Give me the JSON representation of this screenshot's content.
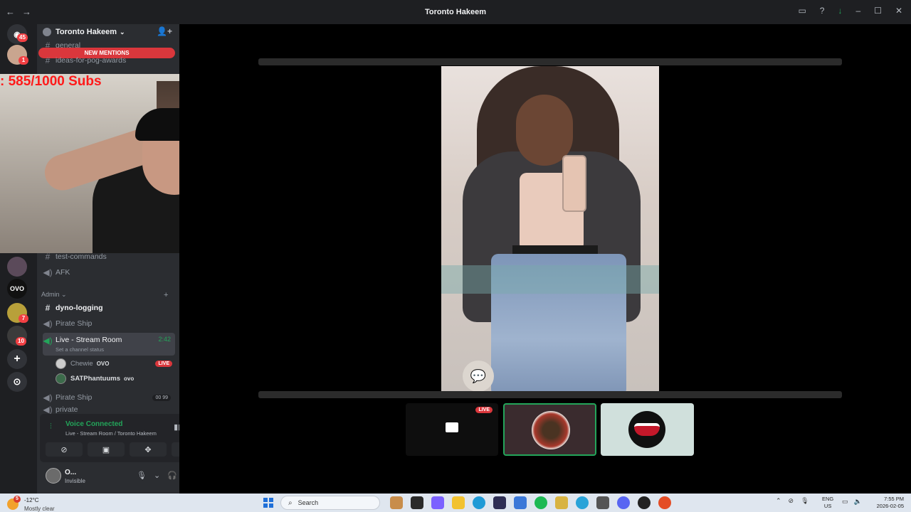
{
  "window": {
    "title": "Toronto Hakeem"
  },
  "server": {
    "name": "Toronto Hakeem"
  },
  "rail": {
    "badges": [
      "45",
      "1",
      "7",
      "10"
    ],
    "ovo_label": "OVO"
  },
  "banner": {
    "new_mentions": "NEW MENTIONS"
  },
  "channels": {
    "general": "general",
    "ideas": "ideas-for-pog-awards",
    "test_commands": "test-commands",
    "afk": "AFK",
    "admin_category": "Admin",
    "dyno": "dyno-logging",
    "pirate_ship_1": "Pirate Ship",
    "live_stream_room": "Live - Stream Room",
    "live_time": "2:42",
    "set_status": "Set a channel status",
    "pirate_ship_2": "Pirate Ship",
    "pirate_counter_a": "00",
    "pirate_counter_b": "99",
    "private": "private"
  },
  "voice_users": [
    {
      "name": "Chewie",
      "tag": "OVO",
      "live": "LIVE"
    },
    {
      "name": "SATPhantuums",
      "tag": "ovo"
    }
  ],
  "voice_panel": {
    "status": "Voice Connected",
    "location": "Live - Stream Room / Toronto Hakeem"
  },
  "user_panel": {
    "name": "O...",
    "status": "Invisible"
  },
  "webcam": {
    "overlay_text": ": 585/1000  Subs"
  },
  "stream_tiles": {
    "live_label": "LIVE"
  },
  "taskbar": {
    "weather_badge": "5",
    "temperature": "-12°C",
    "condition": "Mostly clear",
    "search_placeholder": "Search",
    "language": "ENG",
    "region": "US",
    "time": "7:55 PM",
    "date": "2026-02-05"
  },
  "colors": {
    "accent_green": "#23a55a",
    "live_red": "#da373c",
    "sidebar_bg": "#2b2d31",
    "rail_bg": "#1e1f22"
  }
}
